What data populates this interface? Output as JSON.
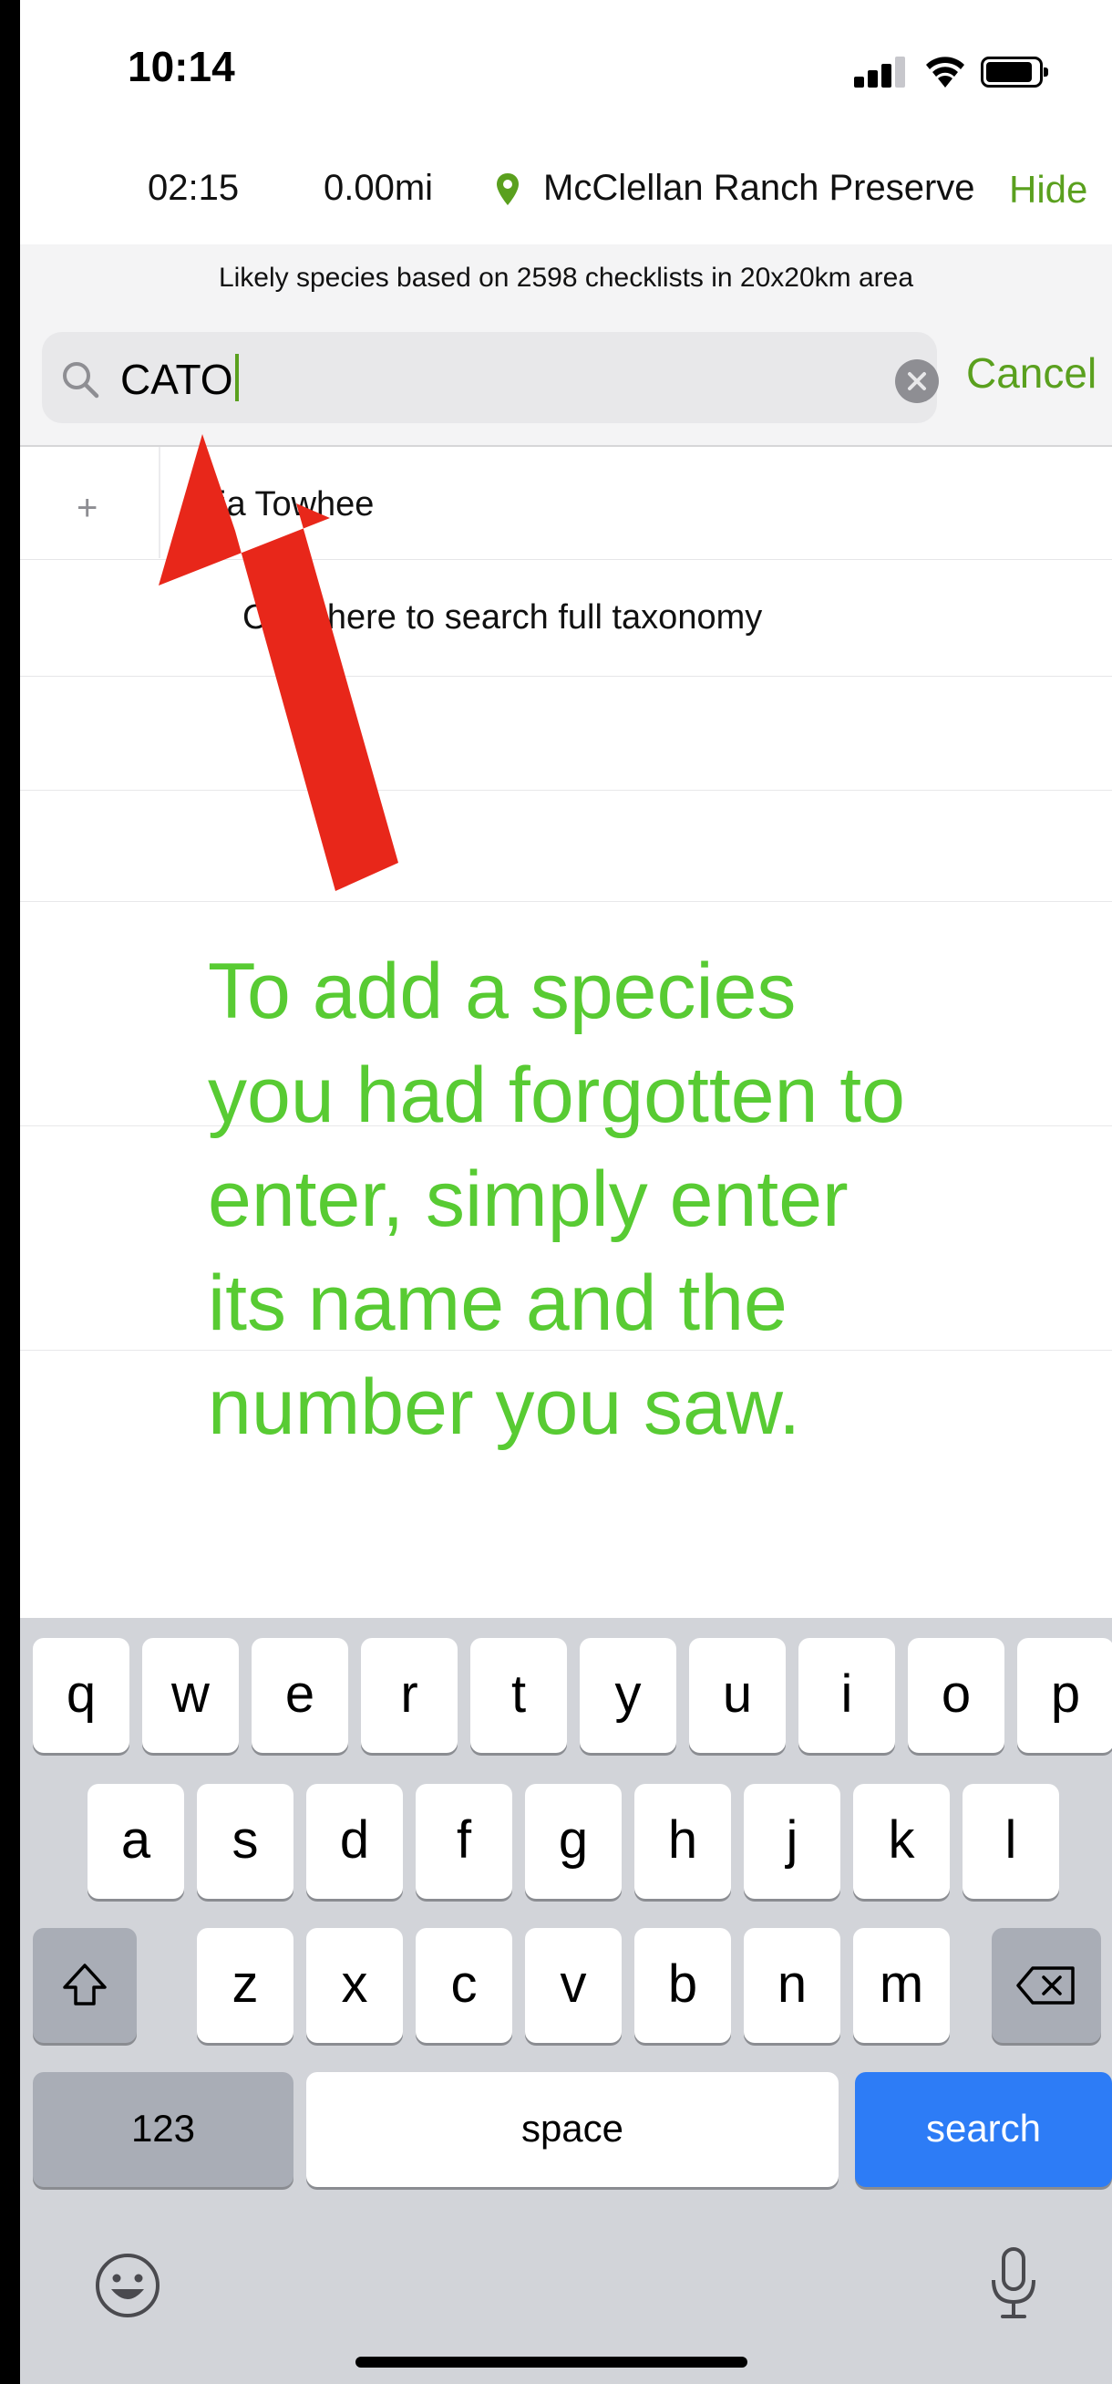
{
  "status_bar": {
    "time": "10:14"
  },
  "tracking": {
    "duration": "02:15",
    "distance": "0.00mi",
    "location": "McClellan Ranch Preserve",
    "hide_label": "Hide"
  },
  "likely_banner": "Likely species based on 2598 checklists in 20x20km area",
  "search": {
    "value": "CATO",
    "cancel_label": "Cancel"
  },
  "results": [
    {
      "label": "ia Towhee"
    },
    {
      "label": "Click here to search full taxonomy"
    }
  ],
  "annotation": {
    "lines": [
      "To add a species",
      "you had forgotten to",
      "enter, simply enter",
      "its name and the",
      "number you saw."
    ],
    "arrow_color": "#e8271a",
    "text_color": "#58cb33"
  },
  "keyboard": {
    "row1": [
      "q",
      "w",
      "e",
      "r",
      "t",
      "y",
      "u",
      "i",
      "o",
      "p"
    ],
    "row2": [
      "a",
      "s",
      "d",
      "f",
      "g",
      "h",
      "j",
      "k",
      "l"
    ],
    "row3": [
      "z",
      "x",
      "c",
      "v",
      "b",
      "n",
      "m"
    ],
    "numbers_label": "123",
    "space_label": "space",
    "search_label": "search"
  },
  "colors": {
    "accent": "#5aa01e",
    "search_key": "#2d7cf6"
  }
}
